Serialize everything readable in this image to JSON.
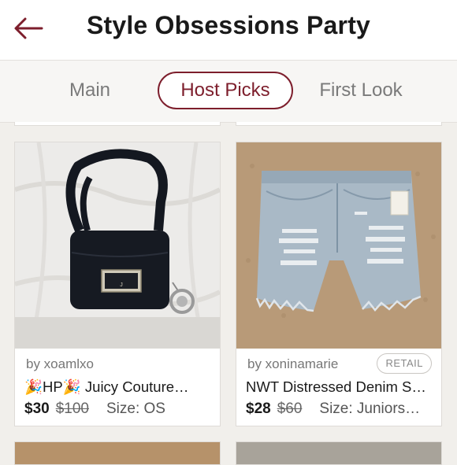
{
  "header": {
    "title": "Style Obsessions Party",
    "back_icon": "back-arrow-icon",
    "accent": "#7d1e2c"
  },
  "tabs": [
    {
      "label": "Main",
      "active": false
    },
    {
      "label": "Host Picks",
      "active": true
    },
    {
      "label": "First Look",
      "active": false
    }
  ],
  "listings": [
    {
      "seller": "by xoamlxo",
      "badge": "",
      "title": "🎉HP🎉 Juicy Couture…",
      "price": "$30",
      "original_price": "$100",
      "size": "Size: OS",
      "image": "black-crossbody-bag-photo"
    },
    {
      "seller": "by xoninamarie",
      "badge": "RETAIL",
      "title": "NWT Distressed Denim S…",
      "price": "$28",
      "original_price": "$60",
      "size": "Size: Juniors…",
      "image": "distressed-denim-shorts-photo"
    }
  ]
}
